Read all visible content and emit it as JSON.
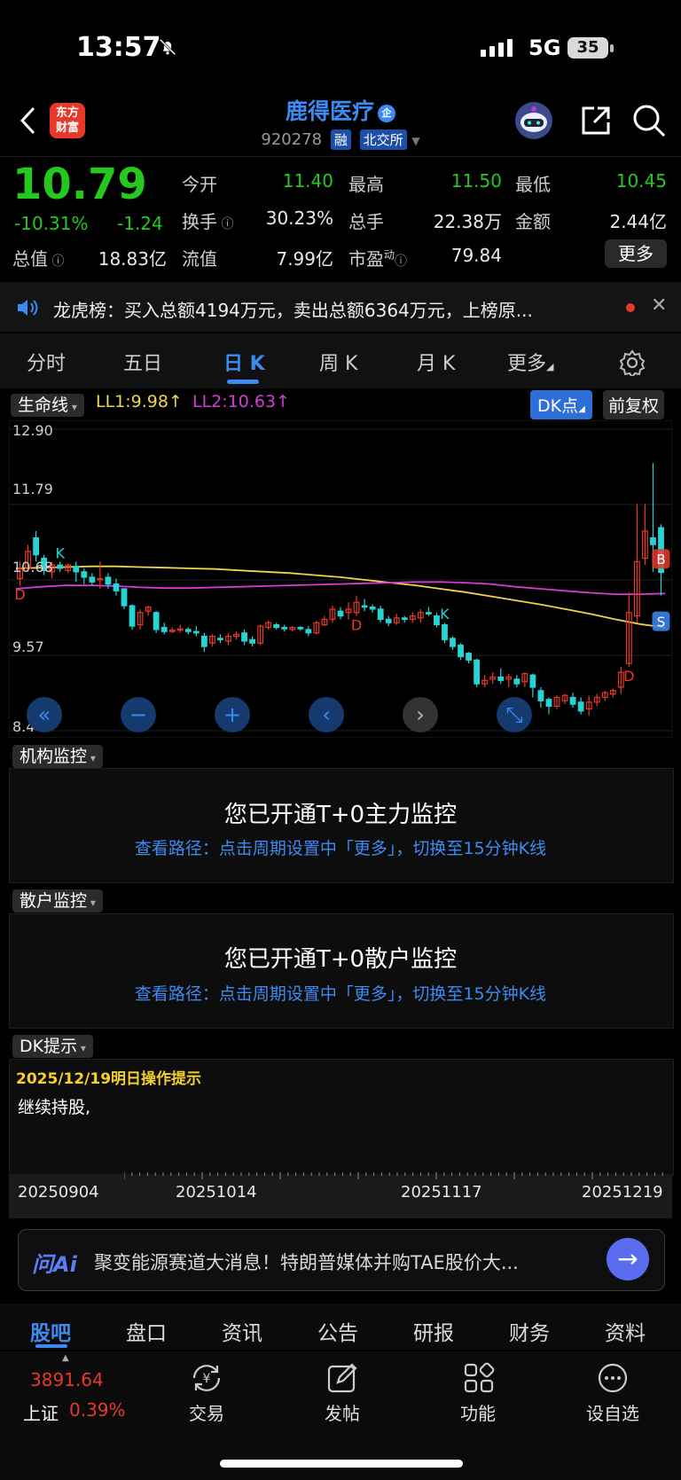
{
  "status_bar": {
    "time": "13:57",
    "network": "5G",
    "battery": "35"
  },
  "header": {
    "logo_text": "东方\n财富",
    "stock_name": "鹿得医疗",
    "name_badge": "企",
    "stock_code": "920278",
    "tag_margin": "融",
    "tag_exchange": "北交所"
  },
  "quote": {
    "price": "10.79",
    "change_pct": "-10.31%",
    "change_amt": "-1.24",
    "open_label": "今开",
    "open_value": "11.40",
    "high_label": "最高",
    "high_value": "11.50",
    "low_label": "最低",
    "low_value": "10.45",
    "turnover_label": "换手",
    "turnover_value": "30.23%",
    "volume_label": "总手",
    "volume_value": "22.38万",
    "amount_label": "金额",
    "amount_value": "2.44亿",
    "mktcap_label": "总值",
    "mktcap_value": "18.83亿",
    "float_label": "流值",
    "float_value": "7.99亿",
    "pe_label": "市盈",
    "pe_sup": "动",
    "pe_value": "79.84",
    "more_label": "更多"
  },
  "news_ticker": {
    "text": "龙虎榜：买入总额4194万元，卖出总额6364万元，上榜原..."
  },
  "period_tabs": [
    "分时",
    "五日",
    "日 K",
    "周 K",
    "月 K",
    "更多"
  ],
  "period_active": "日 K",
  "indicator_bar": {
    "selector": "生命线",
    "ll1": "LL1:9.98",
    "ll2": "LL2:10.63",
    "dk_label": "DK点",
    "adjust_label": "前复权"
  },
  "chart_data": {
    "type": "candlestick",
    "y_ticks": [
      "12.90",
      "11.79",
      "10.68",
      "9.57",
      "8.46"
    ],
    "ylim": [
      8.46,
      12.9
    ],
    "x_labels": [
      "20250904",
      "20251014",
      "20251117",
      "20251219"
    ],
    "lines": [
      {
        "name": "LL1",
        "color": "#f0d54a",
        "values": [
          10.85,
          10.86,
          10.87,
          10.88,
          10.88,
          10.87,
          10.86,
          10.85,
          10.84,
          10.82,
          10.8,
          10.78,
          10.75,
          10.72,
          10.68,
          10.64,
          10.6,
          10.55,
          10.5,
          10.44,
          10.38,
          10.32,
          10.25,
          10.18,
          10.1,
          10.03,
          9.98
        ]
      },
      {
        "name": "LL2",
        "color": "#d63bd6",
        "values": [
          10.55,
          10.58,
          10.6,
          10.6,
          10.59,
          10.57,
          10.56,
          10.56,
          10.57,
          10.58,
          10.59,
          10.6,
          10.61,
          10.62,
          10.63,
          10.64,
          10.65,
          10.65,
          10.64,
          10.62,
          10.58,
          10.55,
          10.52,
          10.49,
          10.47,
          10.47,
          10.48
        ]
      }
    ],
    "candles": [
      [
        10.7,
        10.85,
        10.6,
        10.95
      ],
      [
        10.85,
        11.1,
        10.8,
        11.2
      ],
      [
        11.3,
        11.05,
        10.95,
        11.4
      ],
      [
        11.0,
        10.82,
        10.75,
        11.05
      ],
      [
        10.8,
        10.9,
        10.7,
        10.95
      ],
      [
        10.9,
        10.85,
        10.8,
        10.95
      ],
      [
        10.82,
        10.9,
        10.78,
        10.92
      ],
      [
        10.88,
        10.8,
        10.65,
        10.95
      ],
      [
        10.8,
        10.72,
        10.62,
        10.85
      ],
      [
        10.72,
        10.65,
        10.6,
        10.78
      ],
      [
        10.68,
        10.7,
        10.55,
        10.95
      ],
      [
        10.72,
        10.62,
        10.55,
        10.78
      ],
      [
        10.62,
        10.52,
        10.45,
        10.7
      ],
      [
        10.55,
        10.3,
        10.25,
        10.55
      ],
      [
        10.3,
        10.0,
        9.95,
        10.32
      ],
      [
        10.02,
        10.2,
        9.95,
        10.25
      ],
      [
        10.22,
        10.28,
        10.15,
        10.3
      ],
      [
        10.2,
        9.95,
        9.9,
        10.22
      ],
      [
        9.98,
        9.92,
        9.88,
        10.05
      ],
      [
        9.93,
        9.94,
        9.9,
        9.98
      ],
      [
        9.94,
        9.96,
        9.9,
        10.02
      ],
      [
        9.95,
        9.92,
        9.88,
        9.98
      ],
      [
        9.92,
        9.9,
        9.85,
        10.0
      ],
      [
        9.85,
        9.7,
        9.62,
        9.9
      ],
      [
        9.75,
        9.85,
        9.7,
        9.88
      ],
      [
        9.82,
        9.8,
        9.75,
        9.88
      ],
      [
        9.78,
        9.85,
        9.72,
        9.9
      ],
      [
        9.85,
        9.88,
        9.8,
        9.92
      ],
      [
        9.9,
        9.78,
        9.72,
        9.95
      ],
      [
        9.8,
        9.75,
        9.7,
        9.85
      ],
      [
        9.75,
        10.0,
        9.72,
        10.02
      ],
      [
        9.98,
        10.05,
        9.95,
        10.08
      ],
      [
        10.02,
        9.98,
        9.95,
        10.05
      ],
      [
        9.98,
        9.96,
        9.92,
        10.02
      ],
      [
        9.95,
        9.98,
        9.92,
        10.0
      ],
      [
        9.98,
        9.96,
        9.93,
        10.0
      ],
      [
        9.95,
        9.9,
        9.85,
        10.0
      ],
      [
        9.9,
        10.05,
        9.88,
        10.08
      ],
      [
        10.02,
        10.1,
        10.0,
        10.15
      ],
      [
        10.1,
        10.25,
        10.05,
        10.3
      ],
      [
        10.22,
        10.15,
        10.1,
        10.28
      ],
      [
        10.2,
        10.25,
        10.1,
        10.35
      ],
      [
        10.2,
        10.35,
        10.15,
        10.45
      ],
      [
        10.3,
        10.28,
        10.22,
        10.4
      ],
      [
        10.28,
        10.25,
        10.2,
        10.32
      ],
      [
        10.25,
        10.1,
        10.05,
        10.3
      ],
      [
        10.1,
        10.05,
        10.0,
        10.15
      ],
      [
        10.05,
        10.12,
        10.02,
        10.18
      ],
      [
        10.12,
        10.1,
        10.05,
        10.15
      ],
      [
        10.1,
        10.15,
        10.05,
        10.2
      ],
      [
        10.12,
        10.2,
        10.05,
        10.25
      ],
      [
        10.2,
        10.18,
        10.15,
        10.28
      ],
      [
        10.15,
        10.02,
        9.98,
        10.2
      ],
      [
        10.02,
        9.8,
        9.75,
        10.05
      ],
      [
        9.82,
        9.7,
        9.65,
        9.85
      ],
      [
        9.72,
        9.55,
        9.5,
        9.75
      ],
      [
        9.6,
        9.5,
        9.45,
        9.62
      ],
      [
        9.5,
        9.15,
        9.1,
        9.52
      ],
      [
        9.15,
        9.2,
        9.1,
        9.28
      ],
      [
        9.22,
        9.25,
        9.15,
        9.32
      ],
      [
        9.25,
        9.2,
        9.15,
        9.38
      ],
      [
        9.22,
        9.25,
        9.1,
        9.3
      ],
      [
        9.22,
        9.15,
        9.1,
        9.28
      ],
      [
        9.18,
        9.3,
        9.1,
        9.32
      ],
      [
        9.28,
        9.1,
        8.95,
        9.3
      ],
      [
        9.05,
        8.9,
        8.8,
        9.1
      ],
      [
        8.92,
        8.82,
        8.7,
        8.95
      ],
      [
        8.82,
        8.95,
        8.78,
        8.98
      ],
      [
        8.9,
        8.98,
        8.85,
        9.0
      ],
      [
        8.95,
        8.85,
        8.8,
        9.02
      ],
      [
        8.88,
        8.75,
        8.7,
        8.95
      ],
      [
        8.78,
        8.88,
        8.68,
        8.98
      ],
      [
        8.88,
        8.95,
        8.82,
        9.0
      ],
      [
        8.95,
        9.02,
        8.9,
        9.05
      ],
      [
        9.0,
        9.05,
        8.95,
        9.08
      ],
      [
        9.1,
        9.32,
        9.0,
        9.4
      ],
      [
        9.45,
        10.2,
        9.4,
        10.5
      ],
      [
        10.15,
        10.95,
        10.05,
        11.8
      ],
      [
        11.0,
        11.4,
        10.9,
        11.8
      ],
      [
        11.3,
        11.2,
        10.8,
        12.4
      ],
      [
        11.45,
        10.79,
        10.45,
        11.5
      ]
    ],
    "signals": [
      {
        "label": "D",
        "idx": 0
      },
      {
        "label": "K",
        "idx": 5
      },
      {
        "label": "D",
        "idx": 42
      },
      {
        "label": "K",
        "idx": 53
      },
      {
        "label": "D",
        "idx": 76
      },
      {
        "label": "B",
        "idx": 80
      },
      {
        "label": "S",
        "idx": 80
      }
    ]
  },
  "chart_controls": [
    "«",
    "−",
    "+",
    "‹",
    "›",
    "⤡"
  ],
  "panels": {
    "inst": {
      "header": "机构监控",
      "title": "您已开通T+0主力监控",
      "sub": "查看路径：点击周期设置中「更多」，切换至15分钟K线"
    },
    "retail": {
      "header": "散户监控",
      "title": "您已开通T+0散户监控",
      "sub": "查看路径：点击周期设置中「更多」，切换至15分钟K线"
    },
    "dk": {
      "header": "DK提示",
      "date": "2025/12/19明日操作提示",
      "text": "继续持股,"
    }
  },
  "ai_bar": {
    "logo": "问Ai",
    "text": "聚变能源赛道大消息！特朗普媒体并购TAE股价大..."
  },
  "bottom_tabs": [
    "股吧",
    "盘口",
    "资讯",
    "公告",
    "研报",
    "财务",
    "资料"
  ],
  "index": {
    "value": "3891.64",
    "name": "上证",
    "pct": "0.39%"
  },
  "nav": {
    "trade": "交易",
    "post": "发帖",
    "func": "功能",
    "watch": "设自选"
  },
  "colors": {
    "up": "#e8382a",
    "down": "#27d3d3",
    "accent": "#3d8bf2",
    "price_green": "#25c81e"
  }
}
